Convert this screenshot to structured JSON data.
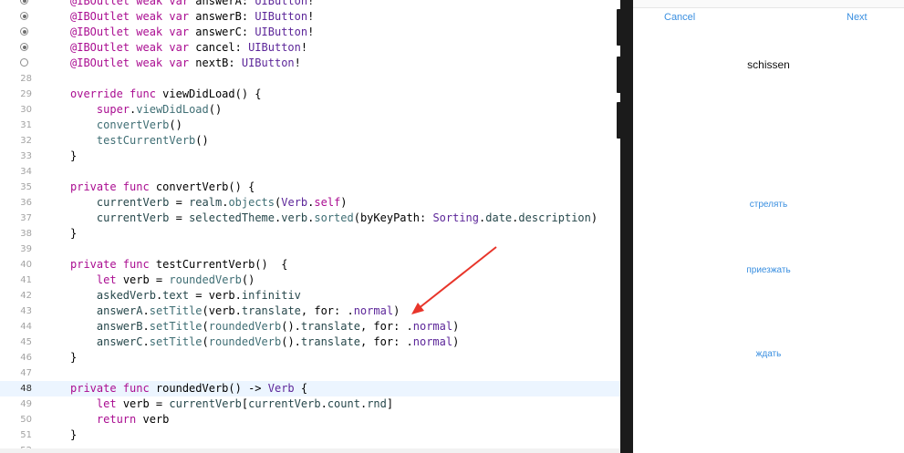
{
  "editor": {
    "lines": [
      {
        "num": "",
        "bp": "filled",
        "tokens": [
          [
            "at",
            "@IBOutlet "
          ],
          [
            "kw",
            "weak var "
          ],
          [
            "lt",
            "answerA: "
          ],
          [
            "ty",
            "UIButton"
          ],
          [
            "lt",
            "!"
          ]
        ]
      },
      {
        "num": "",
        "bp": "filled",
        "tokens": [
          [
            "at",
            "@IBOutlet "
          ],
          [
            "kw",
            "weak var "
          ],
          [
            "lt",
            "answerB: "
          ],
          [
            "ty",
            "UIButton"
          ],
          [
            "lt",
            "!"
          ]
        ]
      },
      {
        "num": "",
        "bp": "filled",
        "tokens": [
          [
            "at",
            "@IBOutlet "
          ],
          [
            "kw",
            "weak var "
          ],
          [
            "lt",
            "answerC: "
          ],
          [
            "ty",
            "UIButton"
          ],
          [
            "lt",
            "!"
          ]
        ]
      },
      {
        "num": "",
        "bp": "filled",
        "tokens": [
          [
            "at",
            "@IBOutlet "
          ],
          [
            "kw",
            "weak var "
          ],
          [
            "lt",
            "cancel: "
          ],
          [
            "ty",
            "UIButton"
          ],
          [
            "lt",
            "!"
          ]
        ]
      },
      {
        "num": "",
        "bp": "empty",
        "tokens": [
          [
            "at",
            "@IBOutlet "
          ],
          [
            "kw",
            "weak var "
          ],
          [
            "lt",
            "nextB: "
          ],
          [
            "ty",
            "UIButton"
          ],
          [
            "lt",
            "!"
          ]
        ]
      },
      {
        "num": "28",
        "bp": "",
        "tokens": []
      },
      {
        "num": "29",
        "bp": "",
        "tokens": [
          [
            "kw",
            "override func "
          ],
          [
            "lt",
            "viewDidLoad() {"
          ]
        ]
      },
      {
        "num": "30",
        "bp": "",
        "tokens": [
          [
            "lt",
            "    "
          ],
          [
            "kw",
            "super"
          ],
          [
            "lt",
            "."
          ],
          [
            "fn",
            "viewDidLoad"
          ],
          [
            "lt",
            "()"
          ]
        ]
      },
      {
        "num": "31",
        "bp": "",
        "tokens": [
          [
            "lt",
            "    "
          ],
          [
            "fn",
            "convertVerb"
          ],
          [
            "lt",
            "()"
          ]
        ]
      },
      {
        "num": "32",
        "bp": "",
        "tokens": [
          [
            "lt",
            "    "
          ],
          [
            "fn",
            "testCurrentVerb"
          ],
          [
            "lt",
            "()"
          ]
        ]
      },
      {
        "num": "33",
        "bp": "",
        "tokens": [
          [
            "lt",
            "}"
          ]
        ]
      },
      {
        "num": "34",
        "bp": "",
        "tokens": []
      },
      {
        "num": "35",
        "bp": "",
        "tokens": [
          [
            "kw",
            "private func "
          ],
          [
            "lt",
            "convertVerb() {"
          ]
        ]
      },
      {
        "num": "36",
        "bp": "",
        "tokens": [
          [
            "lt",
            "    "
          ],
          [
            "pr",
            "currentVerb"
          ],
          [
            "lt",
            " = "
          ],
          [
            "pr",
            "realm"
          ],
          [
            "lt",
            "."
          ],
          [
            "fn",
            "objects"
          ],
          [
            "lt",
            "("
          ],
          [
            "ty",
            "Verb"
          ],
          [
            "lt",
            "."
          ],
          [
            "kw",
            "self"
          ],
          [
            "lt",
            ")"
          ]
        ]
      },
      {
        "num": "37",
        "bp": "",
        "tokens": [
          [
            "lt",
            "    "
          ],
          [
            "pr",
            "currentVerb"
          ],
          [
            "lt",
            " = "
          ],
          [
            "pr",
            "selectedTheme"
          ],
          [
            "lt",
            "."
          ],
          [
            "pr",
            "verb"
          ],
          [
            "lt",
            "."
          ],
          [
            "fn",
            "sorted"
          ],
          [
            "lt",
            "(byKeyPath: "
          ],
          [
            "ty",
            "Sorting"
          ],
          [
            "lt",
            "."
          ],
          [
            "pr",
            "date"
          ],
          [
            "lt",
            "."
          ],
          [
            "pr",
            "description"
          ],
          [
            "lt",
            ")"
          ]
        ]
      },
      {
        "num": "38",
        "bp": "",
        "tokens": [
          [
            "lt",
            "}"
          ]
        ]
      },
      {
        "num": "39",
        "bp": "",
        "tokens": []
      },
      {
        "num": "40",
        "bp": "",
        "tokens": [
          [
            "kw",
            "private func "
          ],
          [
            "lt",
            "testCurrentVerb()  {"
          ]
        ]
      },
      {
        "num": "41",
        "bp": "",
        "tokens": [
          [
            "lt",
            "    "
          ],
          [
            "kw",
            "let "
          ],
          [
            "lt",
            "verb = "
          ],
          [
            "fn",
            "roundedVerb"
          ],
          [
            "lt",
            "()"
          ]
        ]
      },
      {
        "num": "42",
        "bp": "",
        "tokens": [
          [
            "lt",
            "    "
          ],
          [
            "pr",
            "askedVerb"
          ],
          [
            "lt",
            "."
          ],
          [
            "pr",
            "text"
          ],
          [
            "lt",
            " = verb."
          ],
          [
            "pr",
            "infinitiv"
          ]
        ]
      },
      {
        "num": "43",
        "bp": "",
        "tokens": [
          [
            "lt",
            "    "
          ],
          [
            "pr",
            "answerA"
          ],
          [
            "lt",
            "."
          ],
          [
            "fn",
            "setTitle"
          ],
          [
            "lt",
            "(verb."
          ],
          [
            "pr",
            "translate"
          ],
          [
            "lt",
            ", for: ."
          ],
          [
            "ty",
            "normal"
          ],
          [
            "lt",
            ")"
          ]
        ]
      },
      {
        "num": "44",
        "bp": "",
        "tokens": [
          [
            "lt",
            "    "
          ],
          [
            "pr",
            "answerB"
          ],
          [
            "lt",
            "."
          ],
          [
            "fn",
            "setTitle"
          ],
          [
            "lt",
            "("
          ],
          [
            "fn",
            "roundedVerb"
          ],
          [
            "lt",
            "()."
          ],
          [
            "pr",
            "translate"
          ],
          [
            "lt",
            ", for: ."
          ],
          [
            "ty",
            "normal"
          ],
          [
            "lt",
            ")"
          ]
        ]
      },
      {
        "num": "45",
        "bp": "",
        "tokens": [
          [
            "lt",
            "    "
          ],
          [
            "pr",
            "answerC"
          ],
          [
            "lt",
            "."
          ],
          [
            "fn",
            "setTitle"
          ],
          [
            "lt",
            "("
          ],
          [
            "fn",
            "roundedVerb"
          ],
          [
            "lt",
            "()."
          ],
          [
            "pr",
            "translate"
          ],
          [
            "lt",
            ", for: ."
          ],
          [
            "ty",
            "normal"
          ],
          [
            "lt",
            ")"
          ]
        ]
      },
      {
        "num": "46",
        "bp": "",
        "tokens": [
          [
            "lt",
            "}"
          ]
        ]
      },
      {
        "num": "47",
        "bp": "",
        "tokens": []
      },
      {
        "num": "48",
        "bp": "",
        "current": true,
        "tokens": [
          [
            "kw",
            "private func "
          ],
          [
            "lt",
            "roundedVerb() -> "
          ],
          [
            "ty",
            "Verb"
          ],
          [
            "lt",
            " {"
          ]
        ]
      },
      {
        "num": "49",
        "bp": "",
        "tokens": [
          [
            "lt",
            "    "
          ],
          [
            "kw",
            "let "
          ],
          [
            "lt",
            "verb = "
          ],
          [
            "pr",
            "currentVerb"
          ],
          [
            "lt",
            "["
          ],
          [
            "pr",
            "currentVerb"
          ],
          [
            "lt",
            "."
          ],
          [
            "pr",
            "count"
          ],
          [
            "lt",
            "."
          ],
          [
            "pr",
            "rnd"
          ],
          [
            "lt",
            "]"
          ]
        ]
      },
      {
        "num": "50",
        "bp": "",
        "tokens": [
          [
            "lt",
            "    "
          ],
          [
            "kw",
            "return "
          ],
          [
            "lt",
            "verb"
          ]
        ]
      },
      {
        "num": "51",
        "bp": "",
        "tokens": [
          [
            "lt",
            "}"
          ]
        ]
      },
      {
        "num": "52",
        "bp": "",
        "tokens": []
      }
    ]
  },
  "simulator": {
    "cancel_label": "Cancel",
    "next_label": "Next",
    "asked_verb": "schissen",
    "answers": [
      "стрелять",
      "приезжать",
      "ждать"
    ]
  },
  "colors": {
    "keyword": "#aa0d91",
    "type": "#5c2699",
    "function": "#3f6e74",
    "property": "#26474b",
    "button_text": "#3a8fe0",
    "arrow": "#e8352a"
  }
}
